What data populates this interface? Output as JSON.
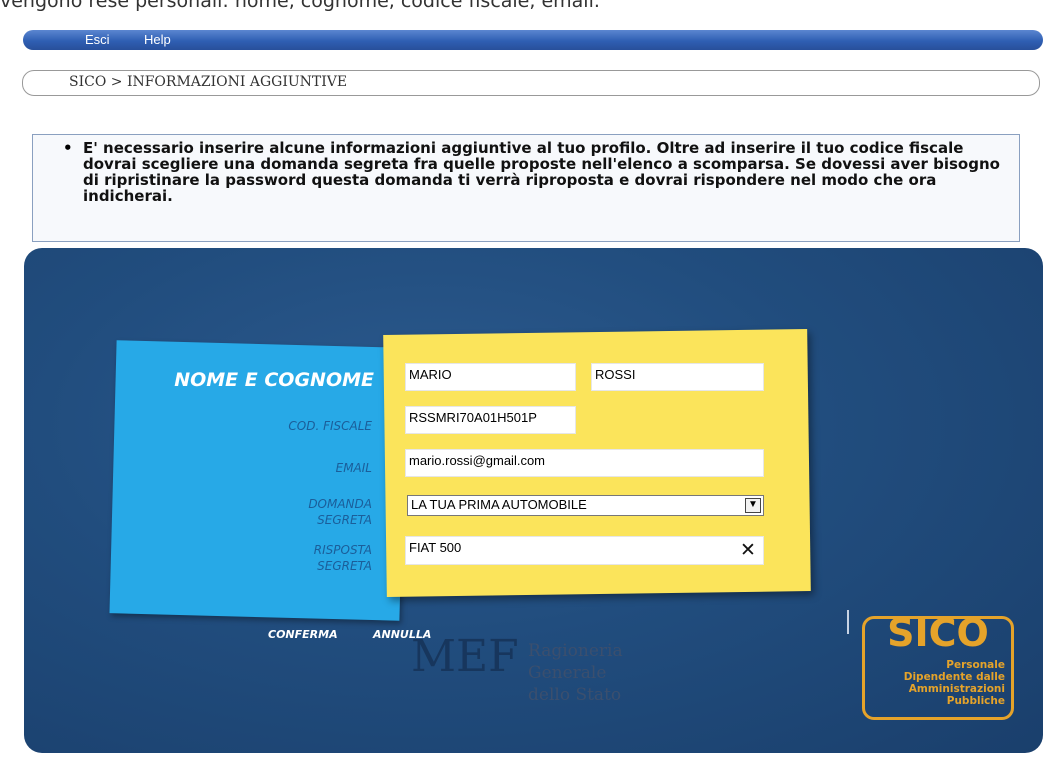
{
  "top_text": "vengono rese personali: nome, cognome, codice fiscale, email.",
  "menu": {
    "exit": "Esci",
    "help": "Help"
  },
  "breadcrumb": "SICO > INFORMAZIONI AGGIUNTIVE",
  "info": {
    "bullet": "•",
    "text": "E' necessario inserire alcune informazioni aggiuntive al tuo profilo. Oltre ad inserire il tuo codice fiscale dovrai scegliere una domanda segreta fra quelle proposte nell'elenco a scomparsa. Se dovessi aver bisogno di ripristinare la password questa domanda ti verrà riproposta e dovrai rispondere nel modo che ora indicherai."
  },
  "form": {
    "labels": {
      "name": "NOME E COGNOME",
      "tax_code": "COD. FISCALE",
      "email": "EMAIL",
      "question": "DOMANDA SEGRETA",
      "answer": "RISPOSTA SEGRETA"
    },
    "values": {
      "first_name": "MARIO",
      "last_name": "ROSSI",
      "tax_code": "RSSMRI70A01H501P",
      "email": "mario.rossi@gmail.com",
      "question": "LA TUA PRIMA AUTOMOBILE",
      "answer": "FIAT 500"
    },
    "clear_symbol": "✕",
    "dropdown_symbol": "▼"
  },
  "actions": {
    "confirm": "CONFERMA",
    "cancel": "ANNULLA"
  },
  "mef_logo": {
    "mark": "MEF",
    "line1": "Ragioneria",
    "line2": "Generale",
    "line3": "dello Stato"
  },
  "sico_logo": {
    "title": "SICO",
    "line1": "Personale",
    "line2": "Dipendente dalle",
    "line3": "Amministrazioni",
    "line4": "Pubbliche"
  },
  "colors": {
    "panel": "#214d7e",
    "blue_note": "#27a9e7",
    "yellow_note": "#fbe45b",
    "sico_orange": "#e5a32a"
  }
}
